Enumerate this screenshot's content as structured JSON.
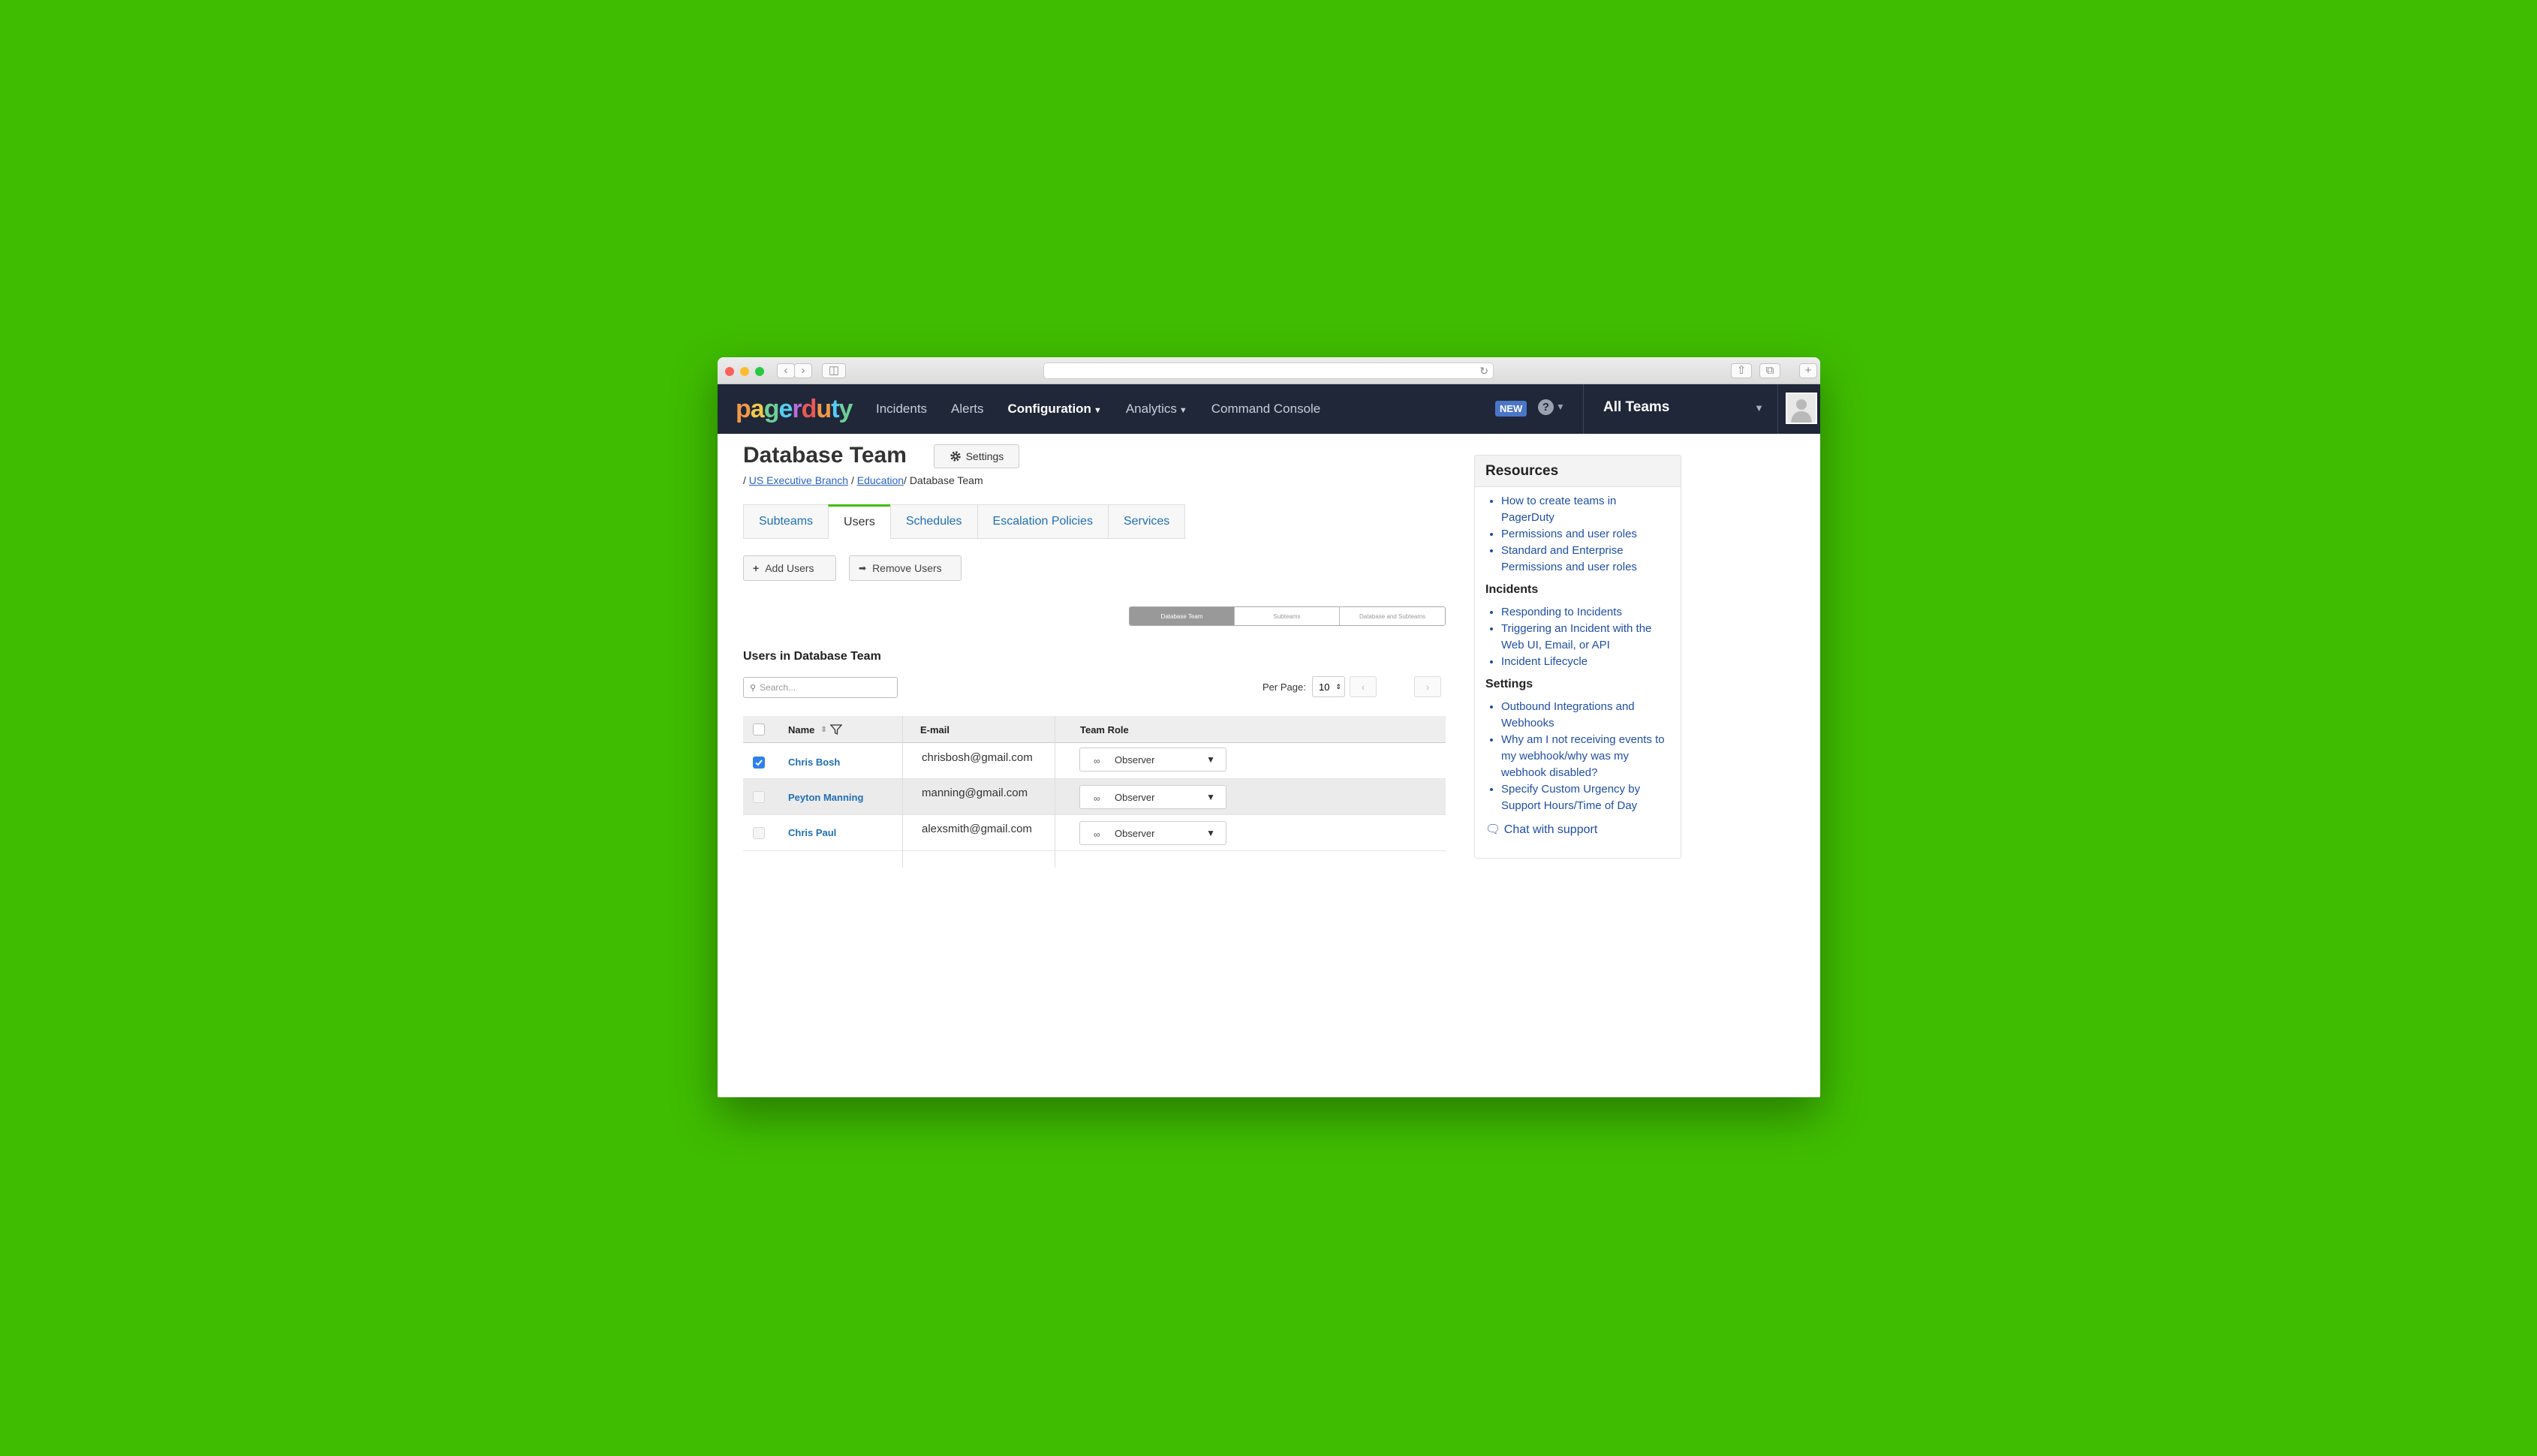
{
  "nav": {
    "logo": "pagerduty",
    "links": [
      {
        "label": "Incidents",
        "caret": false
      },
      {
        "label": "Alerts",
        "caret": false
      },
      {
        "label": "Configuration",
        "caret": true
      },
      {
        "label": "Analytics",
        "caret": true
      },
      {
        "label": "Command Console",
        "caret": false
      }
    ],
    "new_badge": "NEW",
    "help_icon": "?",
    "teams_label": "All Teams"
  },
  "page": {
    "title": "Database Team",
    "settings_label": "Settings",
    "breadcrumb": {
      "sep": "/",
      "parent1": "US Executive Branch",
      "parent2": "Education",
      "current": "Database Team"
    },
    "tabs": [
      "Subteams",
      "Users",
      "Schedules",
      "Escalation Policies",
      "Services"
    ],
    "active_tab": "Users",
    "add_users_label": "Add Users",
    "remove_users_label": "Remove Users",
    "scope_options": [
      "Database Team",
      "Subteams",
      "Database and Subteams"
    ],
    "scope_selected": "Database Team",
    "subheading": "Users in Database Team",
    "search_placeholder": "Search...",
    "per_page_label": "Per Page:",
    "per_page_value": "10",
    "prev_icon": "‹",
    "next_icon": "›"
  },
  "table": {
    "headers": {
      "name": "Name",
      "email": "E-mail",
      "role": "Team Role"
    },
    "rows": [
      {
        "name": "Chris Bosh",
        "email": "chrisbosh@gmail.com",
        "role": "Observer",
        "checked": true
      },
      {
        "name": "Peyton Manning",
        "email": "manning@gmail.com",
        "role": "Observer",
        "checked": false
      },
      {
        "name": "Chris Paul",
        "email": "alexsmith@gmail.com",
        "role": "Observer",
        "checked": false
      }
    ]
  },
  "resources": {
    "title": "Resources",
    "links": [
      "How to create teams in PagerDuty",
      "Permissions and user roles",
      "Standard and Enterprise Permissions and user roles"
    ],
    "incidents_heading": "Incidents",
    "incidents_links": [
      "Responding to Incidents",
      "Triggering an Incident with the Web UI, Email, or API",
      "Incident Lifecycle"
    ],
    "settings_heading": "Settings",
    "settings_links": [
      "Outbound Integrations and Webhooks",
      "Why am I not receiving events to my webhook/why was my webhook disabled?",
      "Specify Custom Urgency by Support Hours/Time of Day"
    ],
    "chat_label": "Chat with support"
  },
  "colors": {
    "background": "#3fbd00",
    "nav": "#1f2738",
    "link": "#1f6fb5",
    "active_tab_accent": "#3fbd00"
  }
}
